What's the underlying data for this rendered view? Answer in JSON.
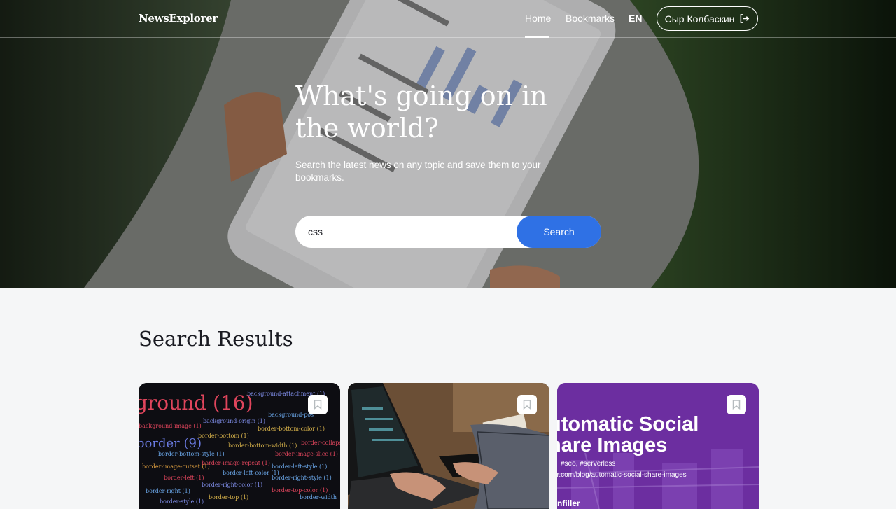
{
  "header": {
    "logo": "NewsExplorer",
    "nav": {
      "home": "Home",
      "bookmarks": "Bookmarks",
      "lang": "EN"
    },
    "user_name": "Сыр Колбаскин"
  },
  "hero": {
    "title": "What's going on in the world?",
    "subtitle": "Search the latest news on any topic and save them to your bookmarks.",
    "search_value": "css",
    "search_button": "Search"
  },
  "results": {
    "title": "Search Results"
  },
  "colors": {
    "accent": "#2f71e5",
    "background": "#f5f6f7",
    "text": "#1a1b22"
  }
}
